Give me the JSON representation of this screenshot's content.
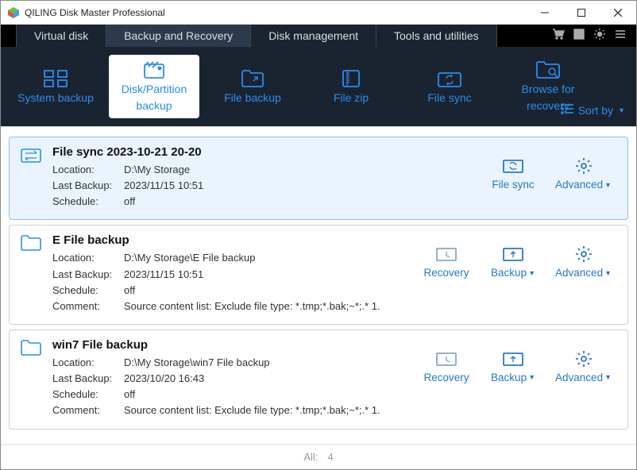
{
  "titlebar": {
    "title": "QILING Disk Master Professional"
  },
  "tabs": {
    "virtual_disk": "Virtual disk",
    "backup_recovery": "Backup and Recovery",
    "disk_management": "Disk management",
    "tools_utilities": "Tools and utilities"
  },
  "tools": {
    "system_backup": "System backup",
    "disk_partition_backup_l1": "Disk/Partition",
    "disk_partition_backup_l2": "backup",
    "file_backup": "File backup",
    "file_zip": "File zip",
    "file_sync": "File sync",
    "browse_recovery_l1": "Browse for",
    "browse_recovery_l2": "recovery",
    "sort_by": "Sort by"
  },
  "labels": {
    "location": "Location:",
    "last_backup": "Last Backup:",
    "schedule": "Schedule:",
    "comment": "Comment:"
  },
  "tasks": [
    {
      "title": "File sync 2023-10-21 20-20",
      "location": "D:\\My Storage",
      "last_backup": "2023/11/15 10:51",
      "schedule": "off",
      "comment": "",
      "actions": {
        "primary": "File sync",
        "advanced": "Advanced"
      },
      "selected": true
    },
    {
      "title": "E  File backup",
      "location": "D:\\My Storage\\E  File backup",
      "last_backup": "2023/11/15 10:51",
      "schedule": "off",
      "comment": "Source content list:  Exclude file type: *.tmp;*.bak;~*;.*        1.",
      "actions": {
        "recovery": "Recovery",
        "backup": "Backup",
        "advanced": "Advanced"
      },
      "selected": false
    },
    {
      "title": "win7 File backup",
      "location": "D:\\My Storage\\win7 File backup",
      "last_backup": "2023/10/20 16:43",
      "schedule": "off",
      "comment": "Source content list:  Exclude file type: *.tmp;*.bak;~*;.*        1.",
      "actions": {
        "recovery": "Recovery",
        "backup": "Backup",
        "advanced": "Advanced"
      },
      "selected": false
    }
  ],
  "footer": {
    "all_label": "All:",
    "all_count": "4"
  }
}
